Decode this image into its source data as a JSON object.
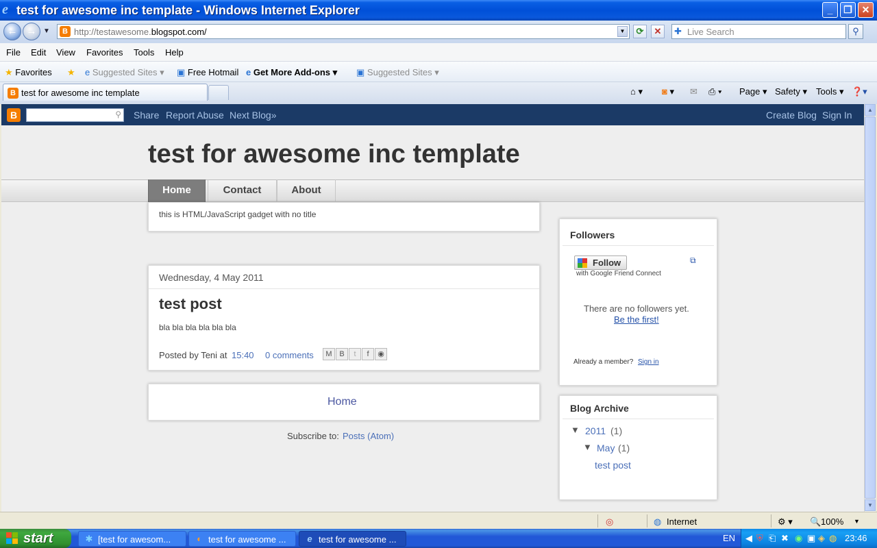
{
  "window": {
    "title": "test for awesome inc template - Windows Internet Explorer"
  },
  "address_bar": {
    "url_prefix": "http://testawesome.",
    "url_domain": "blogspot.com/",
    "search_placeholder": "Live Search"
  },
  "menu": [
    "File",
    "Edit",
    "View",
    "Favorites",
    "Tools",
    "Help"
  ],
  "favorites_bar": {
    "favorites": "Favorites",
    "suggested_1": "Suggested Sites",
    "hotmail": "Free Hotmail",
    "addons": "Get More Add-ons",
    "suggested_2": "Suggested Sites"
  },
  "tab": {
    "title": "test for awesome inc template"
  },
  "command_bar": {
    "page": "Page",
    "safety": "Safety",
    "tools": "Tools"
  },
  "blogger_navbar": {
    "share": "Share",
    "report_abuse": "Report Abuse",
    "next_blog": "Next Blog»",
    "create_blog": "Create Blog",
    "sign_in": "Sign In"
  },
  "blog": {
    "title": "test for awesome inc template",
    "tabs": [
      "Home",
      "Contact",
      "About"
    ],
    "gadget_text": "this is HTML/JavaScript gadget with no title",
    "post": {
      "date": "Wednesday, 4 May 2011",
      "title": "test post",
      "body": "bla bla bla bla bla bla",
      "posted_by": "Posted by Teni at",
      "time": "15:40",
      "comments": "0 comments"
    },
    "home_link": "Home",
    "subscribe_label": "Subscribe to:",
    "subscribe_link": "Posts (Atom)"
  },
  "sidebar": {
    "followers": {
      "heading": "Followers",
      "follow_button": "Follow",
      "gfc_text": "with Google Friend Connect",
      "no_followers": "There are no followers yet.",
      "be_first": "Be the first!",
      "already_member": "Already a member?",
      "sign_in": "Sign in"
    },
    "archive": {
      "heading": "Blog Archive",
      "year": "2011",
      "year_count": "(1)",
      "month": "May",
      "month_count": "(1)",
      "post": "test post"
    }
  },
  "status_bar": {
    "zone": "Internet",
    "zoom": "100%"
  },
  "taskbar": {
    "start": "start",
    "tasks": [
      "[test for awesom...",
      "test for awesome ...",
      "test for awesome ..."
    ],
    "language": "EN",
    "clock": "23:46"
  }
}
